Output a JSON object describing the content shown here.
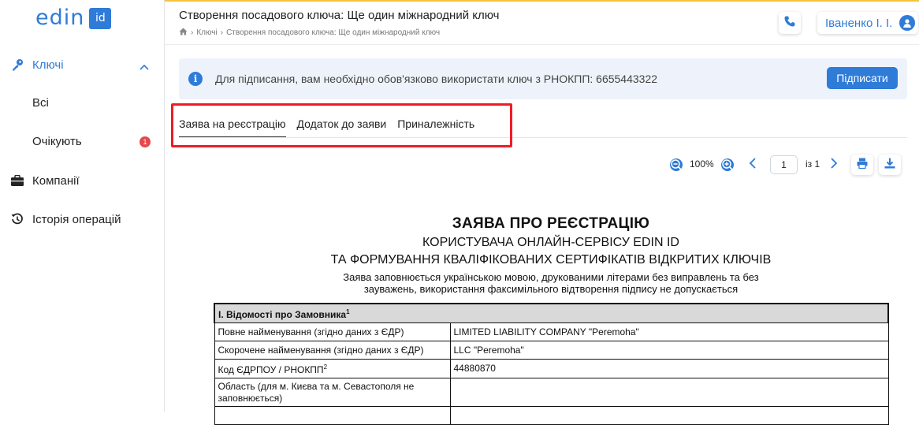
{
  "app": {
    "logo_text": "edin",
    "logo_badge": "id",
    "accent": "#2f7bd8"
  },
  "sidebar": {
    "keys": "Ключі",
    "all": "Всі",
    "pending": "Очікують",
    "pending_count": "1",
    "companies": "Компанії",
    "history": "Історія операцій"
  },
  "header": {
    "title": "Створення посадового ключа: Ще один міжнародний ключ",
    "breadcrumb": [
      "Ключі",
      "Створення посадового ключа: Ще один міжнародний ключ"
    ],
    "user": "Іваненко І. І."
  },
  "banner": {
    "text": "Для підписання, вам необхідно обов'язково використати ключ з РНОКПП: 6655443322",
    "button": "Підписати"
  },
  "tabs": [
    "Заява на реєстрацію",
    "Додаток до заяви",
    "Приналежність"
  ],
  "toolbar": {
    "zoom": "100%",
    "page": "1",
    "page_of": "із 1"
  },
  "document": {
    "title": "ЗАЯВА ПРО РЕЄСТРАЦІЮ",
    "subtitle1": "КОРИСТУВАЧА ОНЛАЙН-СЕРВІСУ EDIN ID",
    "subtitle2": "ТА ФОРМУВАННЯ КВАЛІФІКОВАНИХ СЕРТИФІКАТІВ ВІДКРИТИХ КЛЮЧІВ",
    "note": "Заява заповнюється українською мовою, друкованими літерами без виправлень та без зауважень, використання факсимільного відтворення підпису не допускається",
    "section": "І. Відомості про Замовника",
    "section_sup": "1",
    "rows": [
      {
        "label": "Повне найменування (згідно даних з ЄДР)",
        "value": "LIMITED LIABILITY COMPANY \"Peremoha\""
      },
      {
        "label": "Скорочене найменування (згідно даних з ЄДР)",
        "value": "LLC \"Peremoha\""
      },
      {
        "label": "Код ЄДРПОУ / РНОКПП",
        "label_sup": "2",
        "value": "44880870"
      },
      {
        "label": "Область (для м. Києва та м. Севастополя не заповнюється)",
        "value": ""
      }
    ]
  }
}
